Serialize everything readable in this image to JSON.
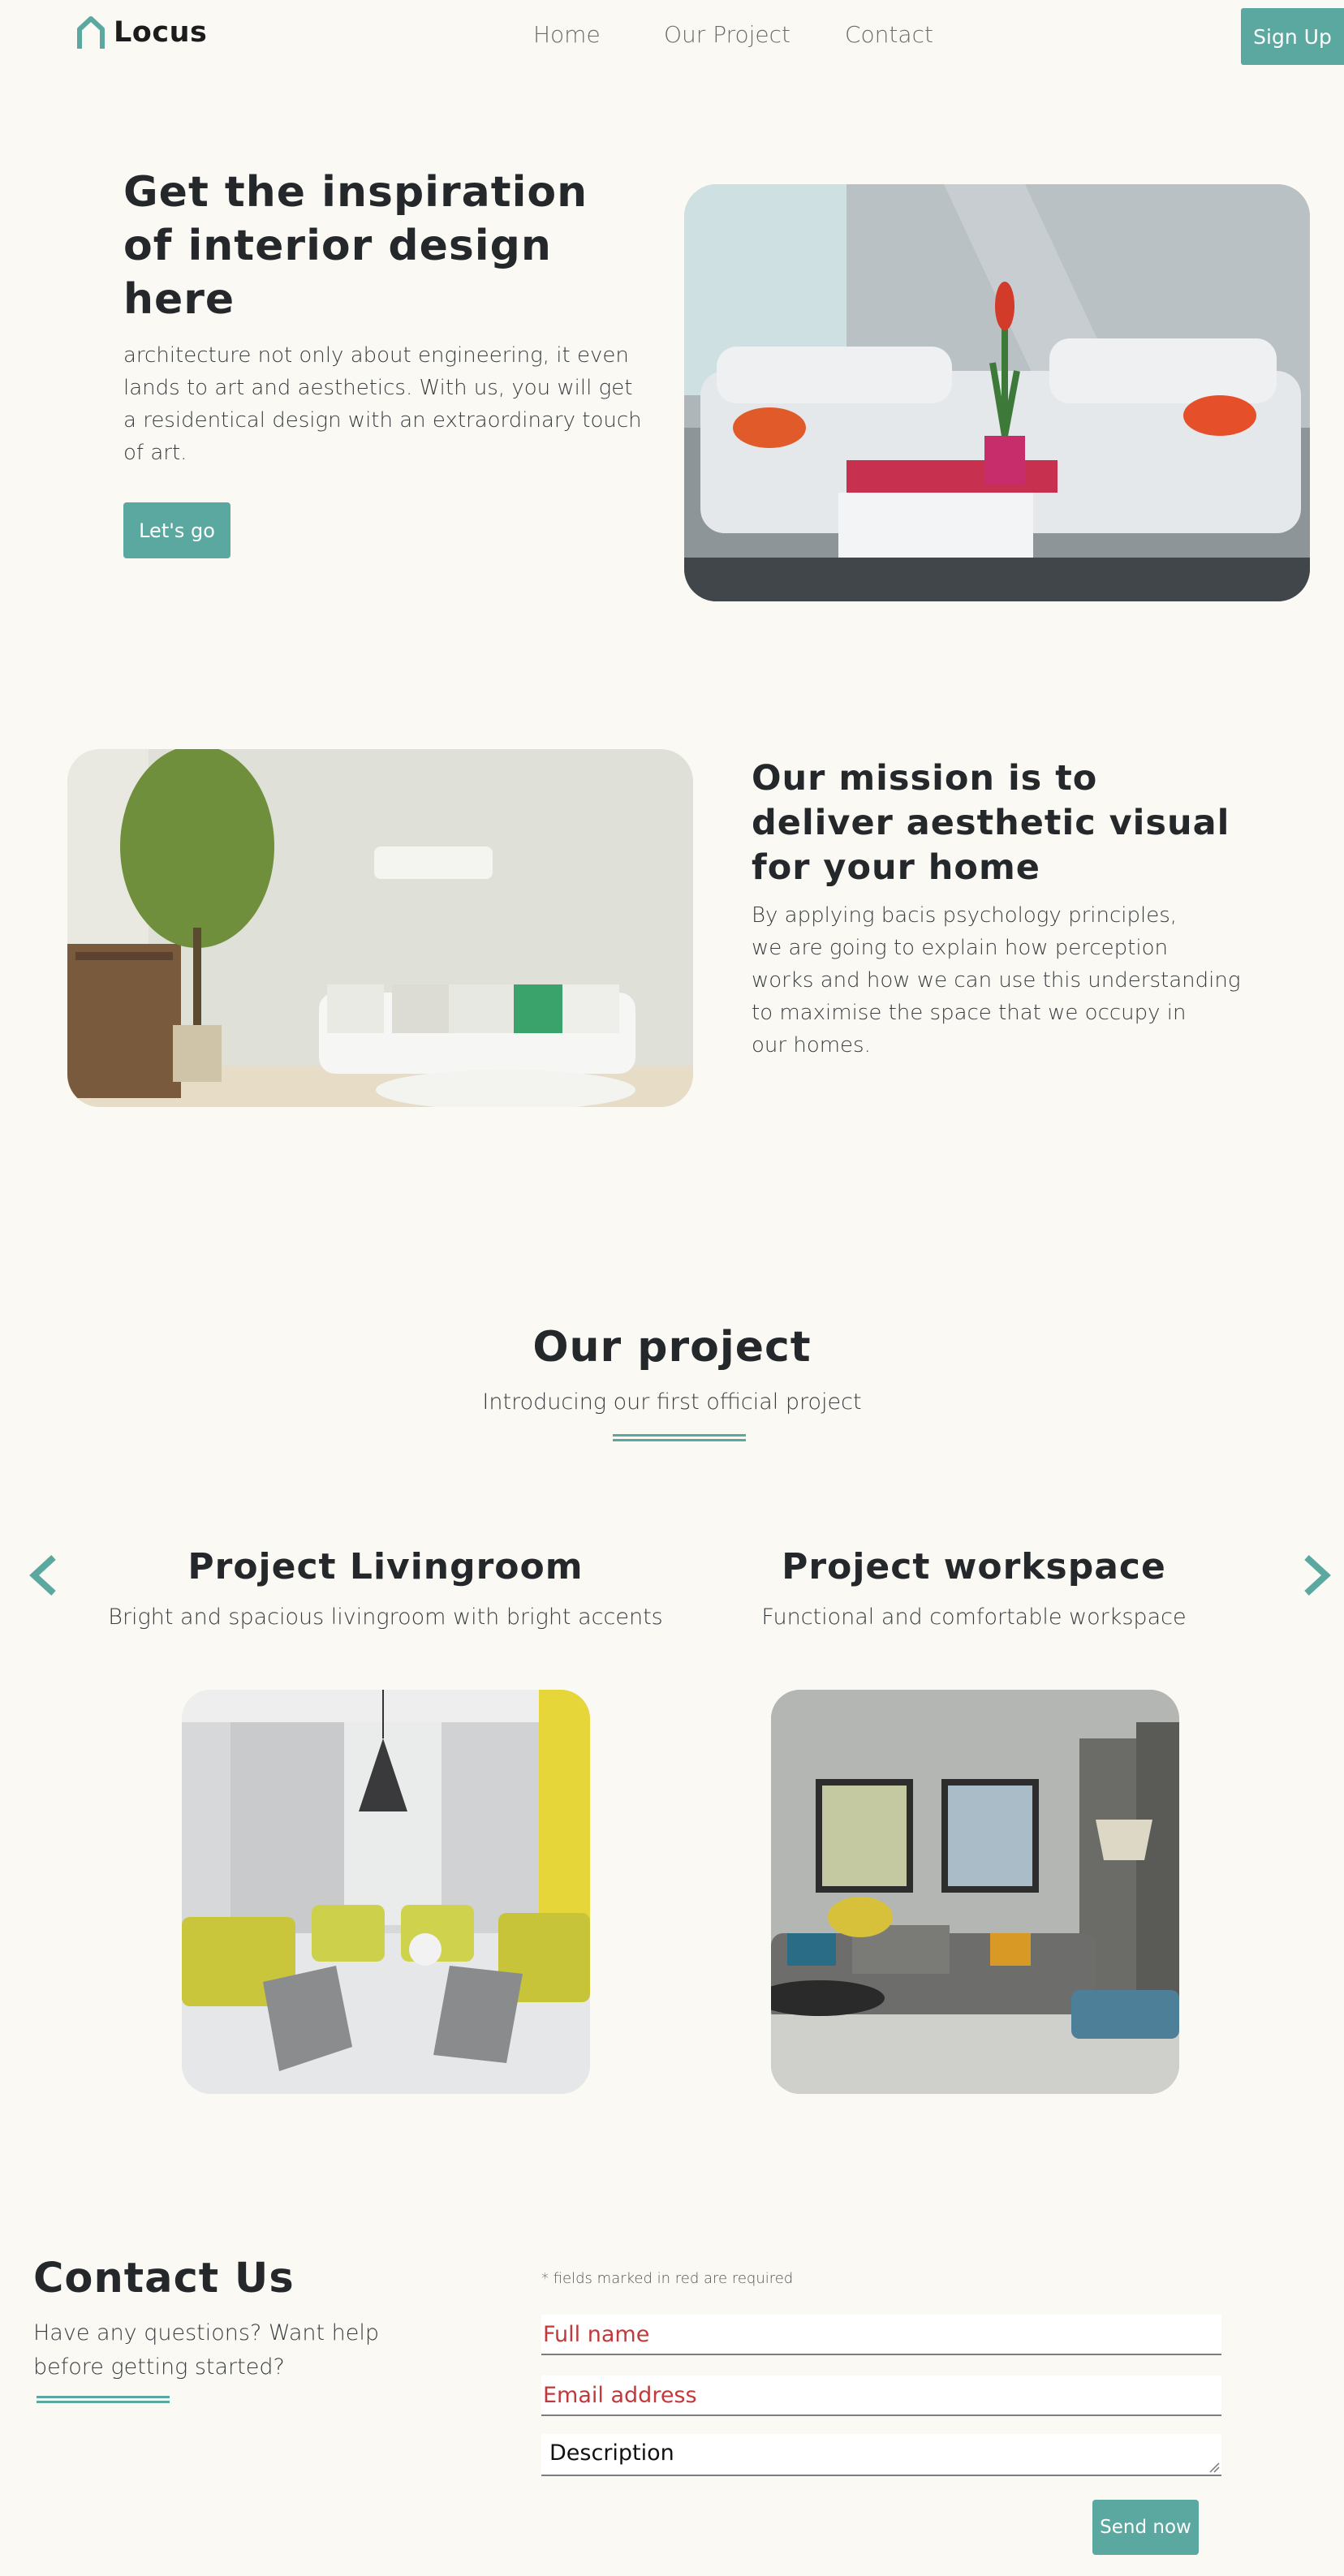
{
  "brand": {
    "name": "Locus",
    "accent": "#5ba8a0"
  },
  "nav": {
    "home": "Home",
    "project": "Our Project",
    "contact": "Contact",
    "signup": "Sign Up"
  },
  "hero": {
    "title_lines": [
      "Get the inspiration",
      "of interior design",
      "here"
    ],
    "body_lines": [
      "architecture not only about engineering, it even",
      "lands to art and aesthetics. With us, you will get",
      "a residentical design with an extraordinary touch",
      "of art."
    ],
    "cta": "Let's go"
  },
  "mission": {
    "title_lines": [
      "Our mission is to",
      "deliver aesthetic visual",
      "for your home"
    ],
    "body_lines": [
      "By applying bacis psychology principles,",
      "we are going to explain how perception",
      "works and how we can use this understanding",
      "to maximise the space that we occupy in",
      "our homes."
    ]
  },
  "projects": {
    "heading": "Our project",
    "subheading": "Introducing our first official project",
    "prev_icon": "chevron-left-icon",
    "next_icon": "chevron-right-icon",
    "items": [
      {
        "title": "Project Livingroom",
        "desc": "Bright and spacious livingroom with bright accents"
      },
      {
        "title": "Project workspace",
        "desc": "Functional and comfortable workspace"
      }
    ]
  },
  "contact": {
    "heading": "Contact Us",
    "sub_lines": [
      "Have any questions? Want help",
      "before getting started?"
    ],
    "required_note": "* fields marked in red are required",
    "name_placeholder": "Full name",
    "email_placeholder": "Email address",
    "description_placeholder": "Description",
    "send": "Send now"
  }
}
